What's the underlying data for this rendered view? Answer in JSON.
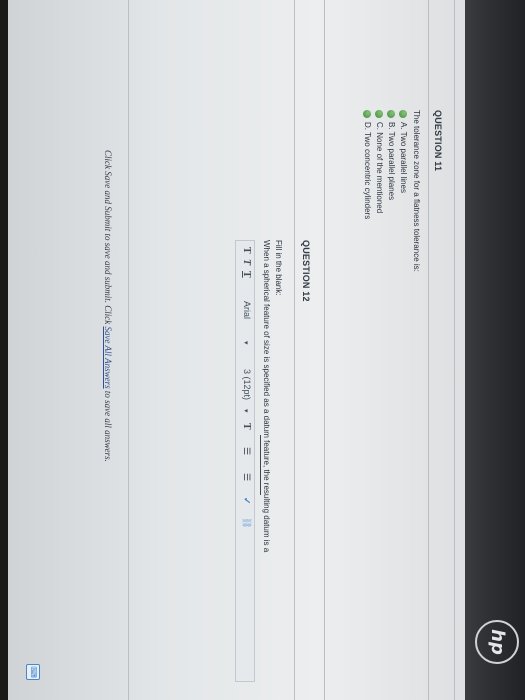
{
  "question11": {
    "heading": "QUESTION 11",
    "prompt": "The tolerance zone for a flatness tolerance is:",
    "options": [
      {
        "label": "A. Two parallel lines"
      },
      {
        "label": "B. Two parallel planes"
      },
      {
        "label": "C. None of the mentioned"
      },
      {
        "label": "D. Two concentric cylinders"
      }
    ]
  },
  "question12": {
    "heading": "QUESTION 12",
    "instruction": "Fill in the blank:",
    "prompt": "When a spherical feature of size is specified as a datum feature, the resulting datum is a",
    "toolbar": {
      "format_t1": "T",
      "format_t2": "T",
      "format_t3": "T",
      "font": "Arial",
      "size": "3 (12pt)",
      "text_color": "T",
      "list1": "☰",
      "list2": "☰",
      "spell": "✓"
    }
  },
  "footer": {
    "prefix": "Click Save and Submit to save and submit. Click",
    "link": "Save All Answers",
    "suffix": "to save all answers."
  },
  "brand": "hp"
}
